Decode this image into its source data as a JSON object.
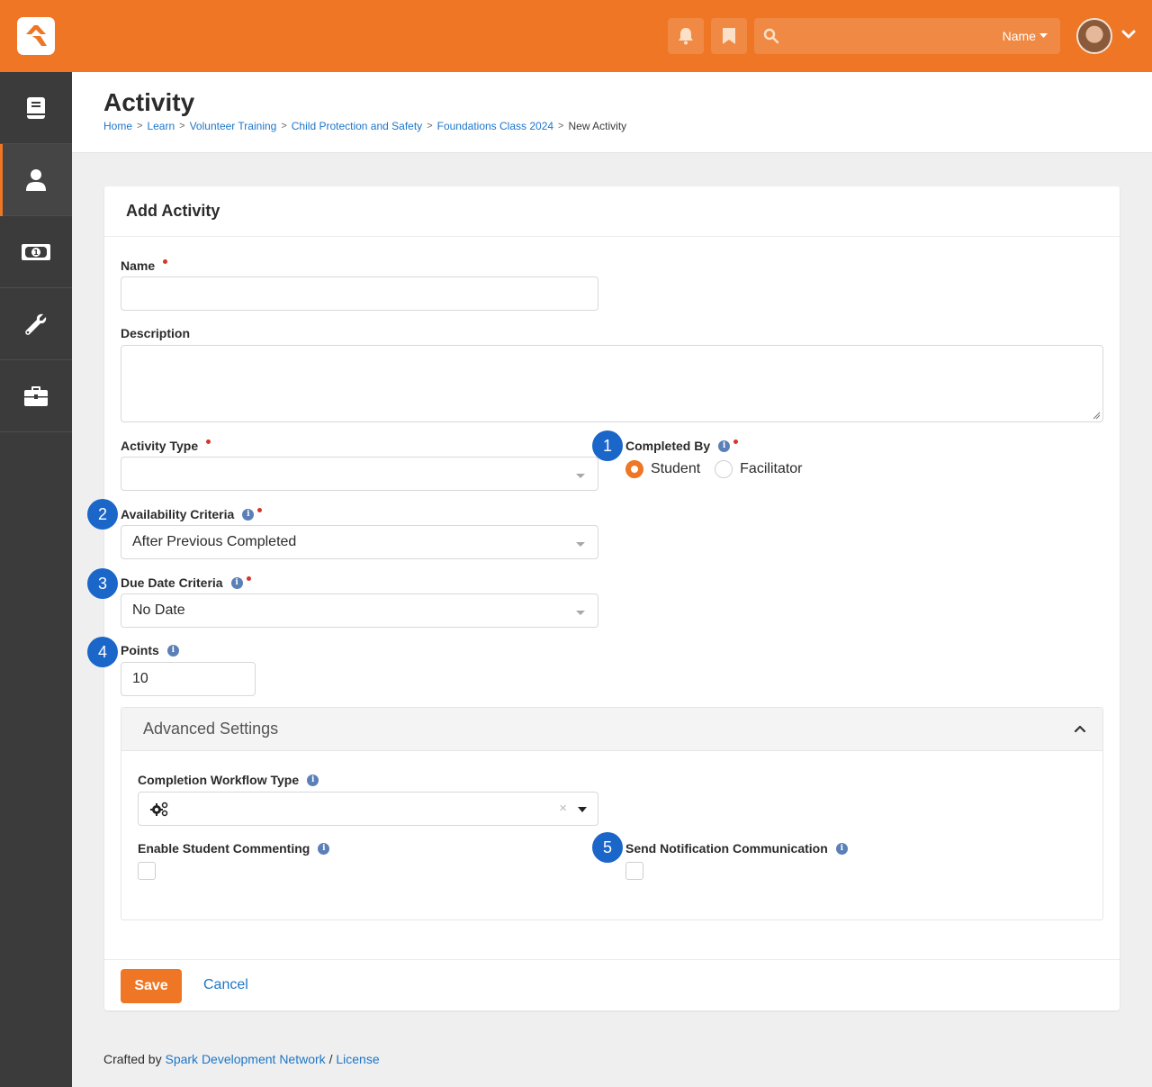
{
  "topbar": {
    "search_scope": "Name",
    "search_placeholder": ""
  },
  "sidebar": {
    "items": [
      {
        "name": "content",
        "icon": "book-icon",
        "active": false
      },
      {
        "name": "people",
        "icon": "user-icon",
        "active": true
      },
      {
        "name": "finance",
        "icon": "money-bill-icon",
        "active": false
      },
      {
        "name": "tools",
        "icon": "wrench-icon",
        "active": false
      },
      {
        "name": "admin",
        "icon": "briefcase-icon",
        "active": false
      }
    ]
  },
  "page": {
    "title": "Activity",
    "breadcrumbs": [
      "Home",
      "Learn",
      "Volunteer Training",
      "Child Protection and Safety",
      "Foundations Class 2024"
    ],
    "breadcrumb_current": "New Activity"
  },
  "panel": {
    "title": "Add Activity",
    "name": {
      "label": "Name",
      "value": "",
      "required": true
    },
    "description": {
      "label": "Description",
      "value": ""
    },
    "activity_type": {
      "label": "Activity Type",
      "value": "",
      "required": true
    },
    "completed_by": {
      "label": "Completed By",
      "required": true,
      "options": [
        "Student",
        "Facilitator"
      ],
      "selected": "Student"
    },
    "availability_criteria": {
      "label": "Availability Criteria",
      "value": "After Previous Completed",
      "required": true
    },
    "due_date_criteria": {
      "label": "Due Date Criteria",
      "value": "No Date",
      "required": true
    },
    "points": {
      "label": "Points",
      "value": "10"
    },
    "advanced": {
      "title": "Advanced Settings",
      "expanded": true,
      "workflow_type": {
        "label": "Completion Workflow Type",
        "value": "",
        "clear_glyph": "×"
      },
      "student_commenting": {
        "label": "Enable Student Commenting",
        "checked": false
      },
      "send_notification": {
        "label": "Send Notification Communication",
        "checked": false
      }
    },
    "save_label": "Save",
    "cancel_label": "Cancel"
  },
  "badges": [
    "1",
    "2",
    "3",
    "4",
    "5"
  ],
  "info_glyph": "i",
  "footer": {
    "prefix": "Crafted by",
    "link1": "Spark Development Network",
    "separator": "/",
    "link2": "License"
  },
  "colors": {
    "brand": "#ee7625",
    "link": "#1d76c8",
    "badge": "#1b66c9",
    "required": "#d4362b"
  }
}
